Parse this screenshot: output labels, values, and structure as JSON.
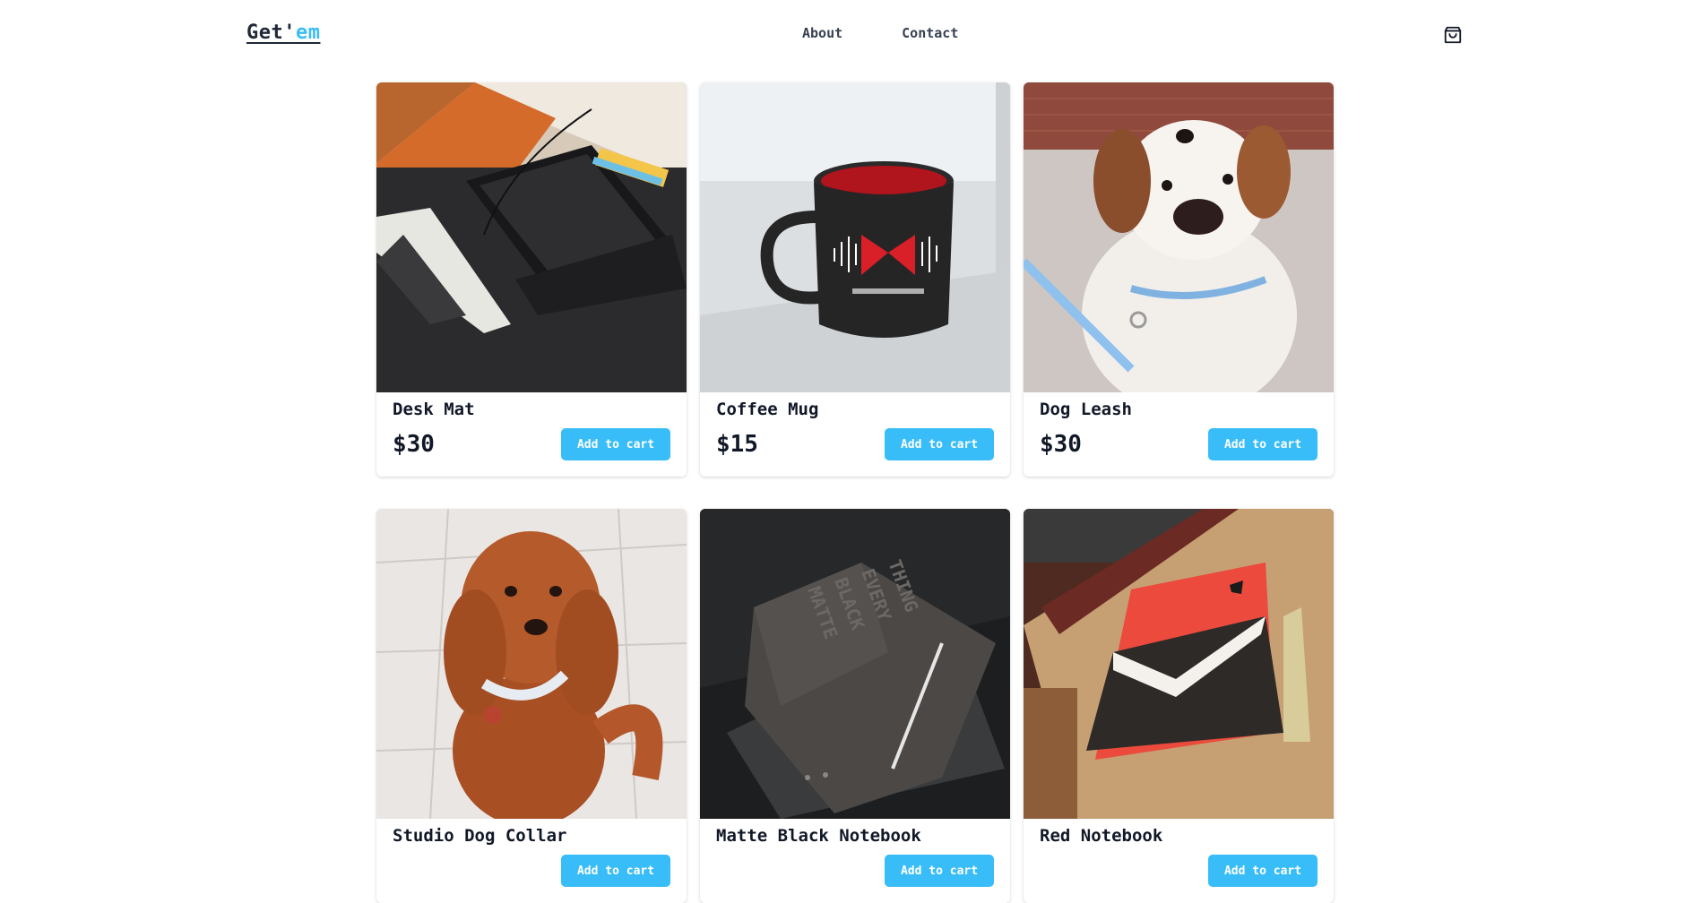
{
  "header": {
    "logo_main": "Get'",
    "logo_accent": "em",
    "nav": [
      {
        "label": "About"
      },
      {
        "label": "Contact"
      }
    ],
    "cart_icon": "shopping-bag-icon"
  },
  "colors": {
    "accent": "#38bdf8",
    "text": "#1f2937"
  },
  "products": [
    {
      "name": "Desk Mat",
      "price": "$30",
      "button": "Add to cart"
    },
    {
      "name": "Coffee Mug",
      "price": "$15",
      "button": "Add to cart"
    },
    {
      "name": "Dog Leash",
      "price": "$30",
      "button": "Add to cart"
    },
    {
      "name": "Studio Dog Collar",
      "price": "",
      "button": "Add to cart"
    },
    {
      "name": "Matte Black Notebook",
      "price": "",
      "button": "Add to cart"
    },
    {
      "name": "Red Notebook",
      "price": "",
      "button": "Add to cart"
    }
  ]
}
